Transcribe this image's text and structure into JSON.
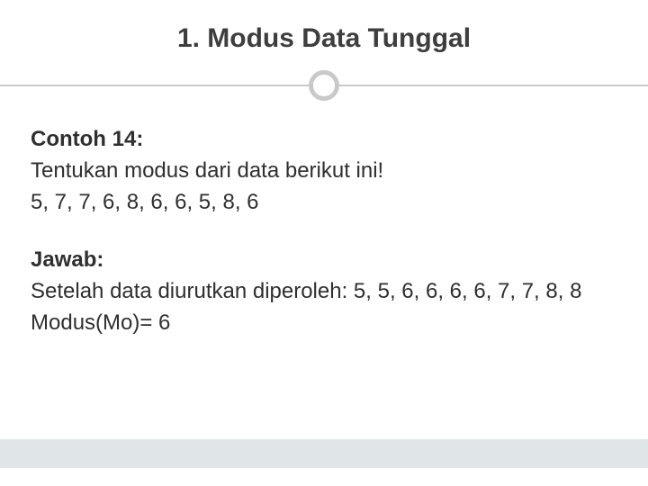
{
  "title": "1. Modus Data Tunggal",
  "q": {
    "heading": "Contoh 14:",
    "prompt": "Tentukan modus dari data berikut ini!",
    "data": "5, 7, 7, 6, 8, 6, 6, 5, 8, 6"
  },
  "a": {
    "heading": "Jawab:",
    "sorted": "Setelah data diurutkan diperoleh: 5, 5, 6, 6, 6, 6, 7, 7, 8, 8",
    "result": "Modus(Mo)= 6"
  }
}
